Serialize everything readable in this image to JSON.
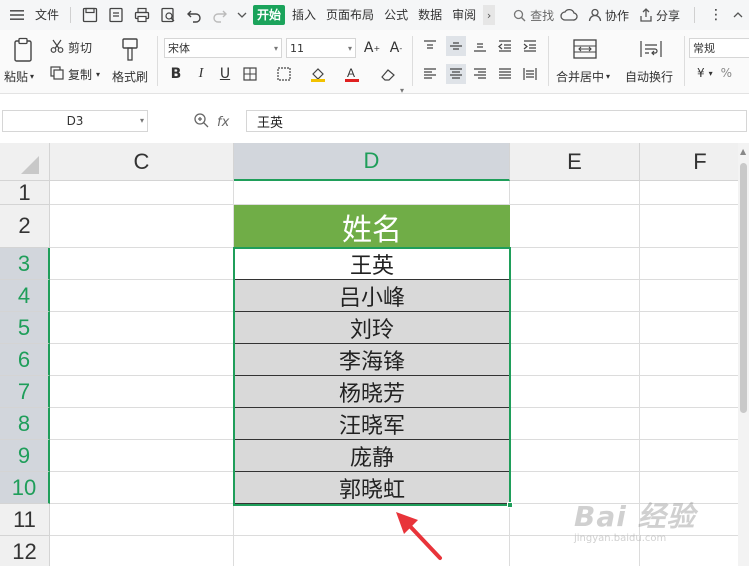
{
  "titlebar": {
    "file_label": "文件",
    "tabs": [
      "开始",
      "插入",
      "页面布局",
      "公式",
      "数据",
      "审阅"
    ],
    "search_label": "查找",
    "collab_label": "协作",
    "share_label": "分享"
  },
  "ribbon": {
    "paste_label": "粘贴",
    "cut_label": "剪切",
    "copy_label": "复制",
    "format_painter_label": "格式刷",
    "font_name": "宋体",
    "font_size": "11",
    "merge_center_label": "合并居中",
    "wrap_text_label": "自动换行",
    "number_format": "常规",
    "currency_symbol": "¥"
  },
  "formula_bar": {
    "name_box": "D3",
    "fx_label": "fx",
    "content": "王英"
  },
  "sheet": {
    "columns": [
      "C",
      "D",
      "E",
      "F"
    ],
    "rows": [
      "1",
      "2",
      "3",
      "4",
      "5",
      "6",
      "7",
      "8",
      "9",
      "10",
      "11",
      "12"
    ],
    "header_cell": "姓名",
    "names": [
      "王英",
      "吕小峰",
      "刘玲",
      "李海锋",
      "杨晓芳",
      "汪晓军",
      "庞静",
      "郭晓虹"
    ]
  },
  "colors": {
    "accent_green": "#1f9e5a",
    "header_fill": "#70ad47",
    "data_fill": "#d9d9d9",
    "arrow_red": "#e8343a"
  },
  "watermark": {
    "brand": "Bai 经验",
    "url": "jingyan.baidu.com"
  }
}
